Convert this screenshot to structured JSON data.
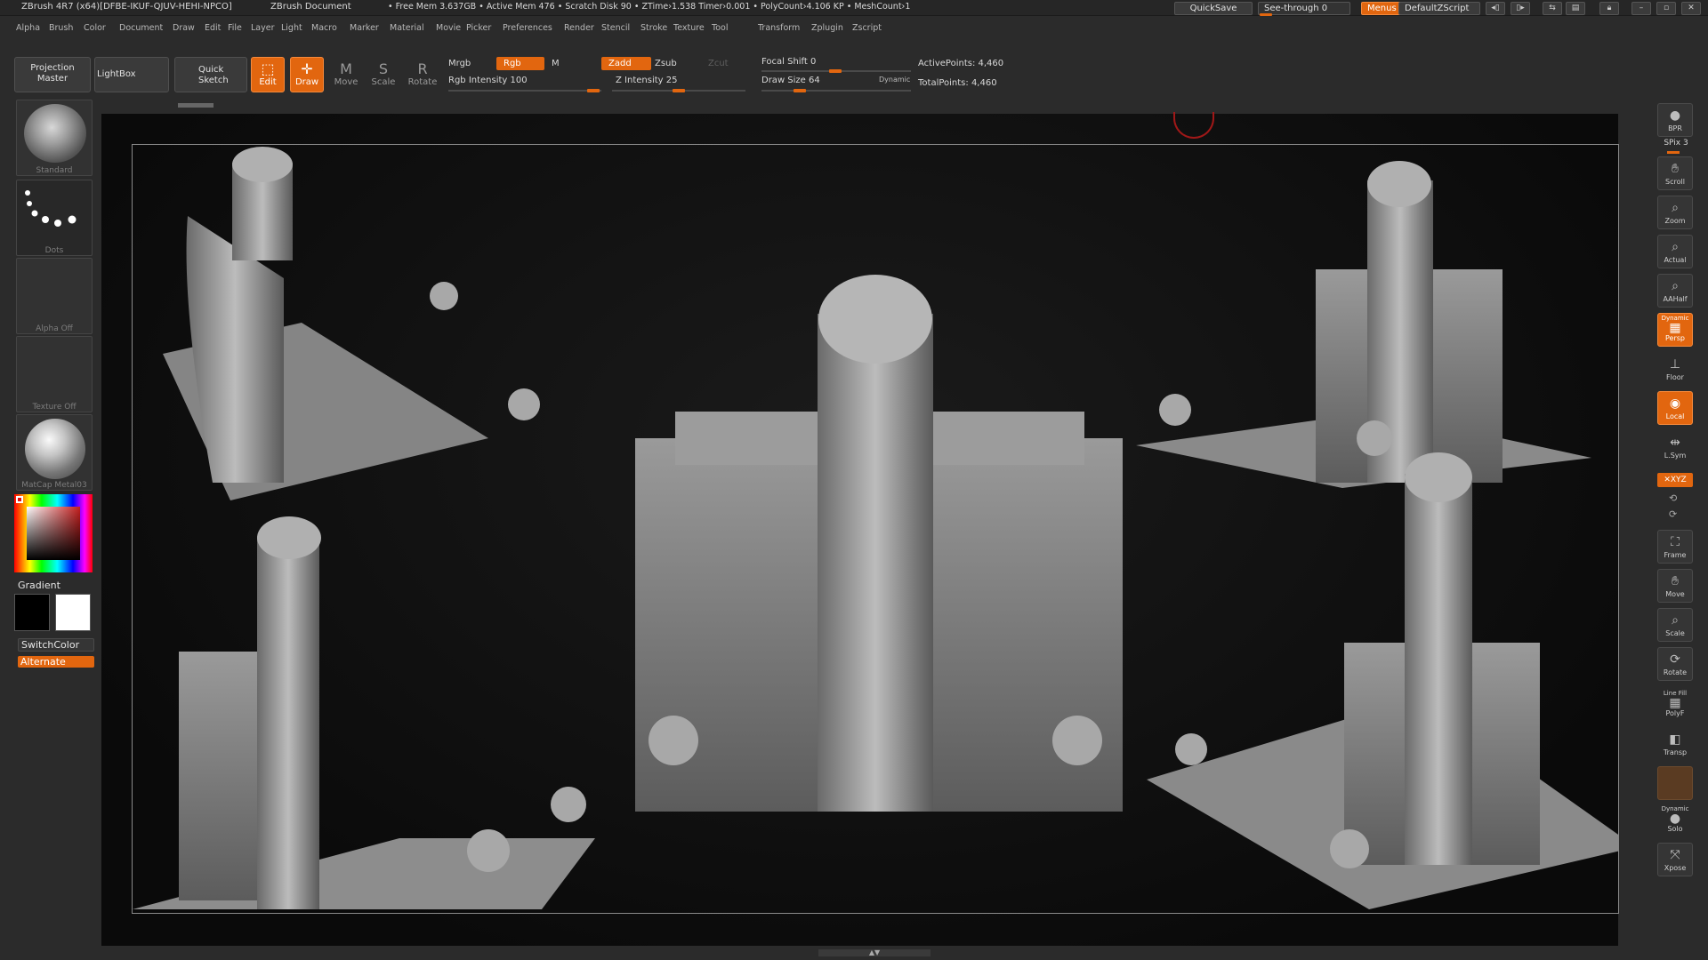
{
  "titlebar": {
    "app_title": "ZBrush 4R7 (x64)[DFBE-IKUF-QJUV-HEHI-NPCO]",
    "doc_title": "ZBrush Document",
    "stats": "• Free Mem 3.637GB • Active Mem 476 • Scratch Disk 90 • ZTime›1.538 Timer›0.001 • PolyCount›4.106 KP • MeshCount›1",
    "quicksave": "QuickSave",
    "see_through": "See-through 0",
    "menus": "Menus",
    "default_zscript": "DefaultZScript"
  },
  "menubar": {
    "items": [
      "Alpha",
      "Brush",
      "Color",
      "Document",
      "Draw",
      "Edit",
      "File",
      "Layer",
      "Light",
      "Macro",
      "Marker",
      "Material",
      "Movie",
      "Picker",
      "Preferences",
      "Render",
      "Stencil",
      "Stroke",
      "Texture",
      "Tool",
      "Transform",
      "Zplugin",
      "Zscript"
    ]
  },
  "toolbar": {
    "projection_master": "Projection Master",
    "lightbox": "LightBox",
    "quick_sketch": "Quick Sketch",
    "edit": "Edit",
    "draw": "Draw",
    "move": "Move",
    "scale": "Scale",
    "rotate": "Rotate",
    "mrgb": "Mrgb",
    "rgb": "Rgb",
    "m": "M",
    "rgb_intensity": "Rgb Intensity 100",
    "zadd": "Zadd",
    "zsub": "Zsub",
    "zcut": "Zcut",
    "z_intensity": "Z Intensity 25",
    "focal_shift": "Focal Shift 0",
    "draw_size": "Draw Size 64",
    "dynamic": "Dynamic",
    "active_points": "ActivePoints: 4,460",
    "total_points": "TotalPoints: 4,460"
  },
  "lefttray": {
    "brush": "Standard",
    "stroke": "Dots",
    "alpha": "Alpha Off",
    "texture": "Texture Off",
    "material": "MatCap Metal03",
    "gradient": "Gradient",
    "switchcolor": "SwitchColor",
    "alternate": "Alternate"
  },
  "rightshelf": {
    "bpr": "BPR",
    "spix": "SPix 3",
    "scroll": "Scroll",
    "zoom": "Zoom",
    "actual": "Actual",
    "aahalf": "AAHalf",
    "dynamic": "Dynamic",
    "persp": "Persp",
    "floor": "Floor",
    "local": "Local",
    "lsym": "L.Sym",
    "xyz": "✕XYZ",
    "frame": "Frame",
    "move": "Move",
    "scale": "Scale",
    "rotate": "Rotate",
    "line_fill": "Line Fill",
    "polyf": "PolyF",
    "transp": "Transp",
    "dynamic2": "Dynamic",
    "solo": "Solo",
    "xpose": "Xpose"
  },
  "colors": {
    "accent": "#e2660f",
    "panel": "#2b2b2b",
    "canvas": "#0f0f0f"
  }
}
